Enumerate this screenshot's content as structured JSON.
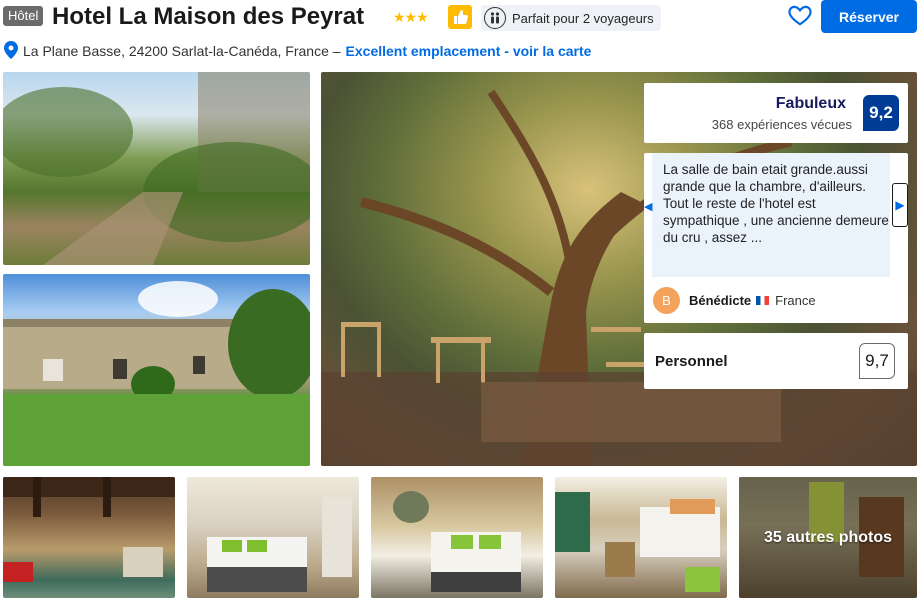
{
  "header": {
    "type_badge": "Hôtel",
    "hotel_name": "Hotel La Maison des Peyrat",
    "stars": "★★★",
    "traveller_pill": "Parfait pour 2 voyageurs",
    "reserve_label": "Réserver"
  },
  "address": {
    "text": "La Plane Basse, 24200 Sarlat-la-Canéda, France –",
    "map_link": "Excellent emplacement - voir la carte"
  },
  "rating": {
    "word": "Fabuleux",
    "count": "368 expériences vécues",
    "score": "9,2"
  },
  "review": {
    "text": "La salle de bain etait grande.aussi grande que la chambre, d'ailleurs. Tout le reste de l'hotel est sympathique , une ancienne demeure du cru , assez ...",
    "avatar_letter": "B",
    "reviewer_name": "Bénédicte",
    "country": "France"
  },
  "staff": {
    "label": "Personnel",
    "score": "9,7"
  },
  "gallery": {
    "more_photos": "35 autres photos"
  },
  "colors": {
    "primary_blue": "#006ce4",
    "score_navy": "#003b95",
    "star_yellow": "#febb02"
  },
  "icons": [
    "thumbs-up-icon",
    "travellers-icon",
    "heart-icon",
    "map-pin-icon",
    "chevron-left-icon",
    "chevron-right-icon"
  ]
}
